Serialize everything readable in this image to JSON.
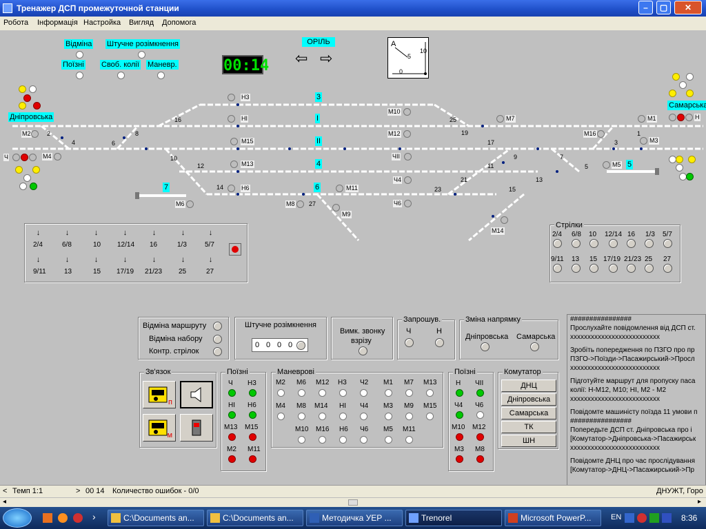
{
  "window": {
    "title": "Тренажер ДСП промежуточной станции",
    "min": "–",
    "max": "▢",
    "close": "✕"
  },
  "menu": [
    "Робота",
    "Інформація",
    "Настройка",
    "Вигляд",
    "Допомога"
  ],
  "legend": {
    "cancel": "Відміна",
    "artificial": "Штучне розімкнення",
    "train": "Поїзні",
    "free_tracks": "Своб. колії",
    "shunt": "Маневр."
  },
  "clock": "00:14",
  "direction": {
    "name": "ОРІЛЬ",
    "left": "⇦",
    "right": "⇨"
  },
  "meter": {
    "a": "A",
    "five": "5",
    "ten": "10",
    "zero": "0"
  },
  "stations": {
    "left": "Дніпровська",
    "right": "Самарська"
  },
  "tracks": [
    "3",
    "I",
    "II",
    "4",
    "6",
    "5",
    "7"
  ],
  "signals": [
    "Н3",
    "НІ",
    "М15",
    "М13",
    "Н6",
    "М11",
    "М10",
    "М12",
    "ЧІІ",
    "Ч4",
    "Ч6",
    "М7",
    "М1",
    "М16",
    "М3",
    "М5",
    "М2",
    "М4",
    "М6",
    "М8",
    "М9",
    "М14",
    "Н",
    "Ч"
  ],
  "switch_nums": [
    "2",
    "4",
    "6",
    "8",
    "10",
    "12",
    "14",
    "16",
    "25",
    "19",
    "17",
    "27",
    "21",
    "23",
    "15",
    "13",
    "11",
    "9",
    "7",
    "5",
    "3",
    "1"
  ],
  "routes": {
    "top": [
      "2/4",
      "6/8",
      "10",
      "12/14",
      "16",
      "1/3",
      "5/7"
    ],
    "bottom": [
      "9/11",
      "13",
      "15",
      "17/19",
      "21/23",
      "25",
      "27"
    ]
  },
  "strilky": {
    "title": "Стрілки",
    "top": [
      "2/4",
      "6/8",
      "10",
      "12/14",
      "16",
      "1/3",
      "5/7"
    ],
    "bottom": [
      "9/11",
      "13",
      "15",
      "17/19",
      "21/23",
      "25",
      "27"
    ]
  },
  "controls": {
    "cancel_route": "Відміна маршруту",
    "cancel_set": "Відміна набору",
    "check_switches": "Контр. стрілок",
    "artificial": "Штучне розімкнення",
    "digits": [
      "0",
      "0",
      "0",
      "0"
    ],
    "bell": "Вимк. звонку",
    "bell2": "взрізу",
    "request": "Запрошув.",
    "ch": "Ч",
    "n": "Н",
    "voltage": "Зміна напрямку",
    "dnipro": "Дніпровська",
    "samar": "Самарська"
  },
  "comm": {
    "title": "Зв'язок",
    "p": "п",
    "m": "м"
  },
  "train_left": {
    "title": "Поїзні",
    "items": [
      "Ч",
      "Н3",
      "НІ",
      "Н6",
      "М13",
      "М15",
      "М2",
      "М11"
    ]
  },
  "shunt": {
    "title": "Маневрові",
    "row1": [
      "М2",
      "М6",
      "М12",
      "Н3",
      "Ч2",
      "М1",
      "М7",
      "М13"
    ],
    "row2": [
      "М4",
      "М8",
      "М14",
      "НІ",
      "Ч4",
      "М3",
      "М9",
      "М15"
    ],
    "row3": [
      "М10",
      "М16",
      "Н6",
      "Ч6",
      "М5",
      "М11"
    ]
  },
  "train_right": {
    "title": "Поїзні",
    "items": [
      "Н",
      "ЧІІ",
      "Ч4",
      "Ч6",
      "М10",
      "М12",
      "М3",
      "М8"
    ]
  },
  "commutator": {
    "title": "Комутатор",
    "buttons": [
      "ДНЦ",
      "Дніпровська",
      "Самарська",
      "ТК",
      "ШН"
    ]
  },
  "messages": [
    "################",
    "Прослухайте повідомлення від ДСП ст.",
    "xxxxxxxxxxxxxxxxxxxxxxxxxx",
    "Зробіть попередження по ПЗГО про пр",
    "ПЗГО->Поїзди->Пасажирський->Просл",
    "xxxxxxxxxxxxxxxxxxxxxxxxxx",
    "Підготуйте маршрут для пропуску паса",
    "колії: Н-М12, М10; НІ, М2 - М2",
    "xxxxxxxxxxxxxxxxxxxxxxxxxx",
    "Повідомте машиністу поїзда 11 умови п",
    "################",
    "Попередьте ДСП ст. Дніпровська про і",
    "[Комутатор->Дніпровська->Пасажирськ",
    "xxxxxxxxxxxxxxxxxxxxxxxxxx",
    "Повідомте ДНЦ про час прослідування",
    "[Комутатор->ДНЦ->Пасажирський->Пр"
  ],
  "status": {
    "arrow_l": "<",
    "tempo": "Темп 1:1",
    "arrow_r": ">",
    "time": "00  14",
    "errors": "Количество ошибок - 0/0",
    "right": "ДНУЖТ, Горо"
  },
  "taskbar": {
    "start": "",
    "items": [
      "C:\\Documents an...",
      "C:\\Documents an...",
      "Методичка УЕР ...",
      "Trenorel",
      "Microsoft PowerP..."
    ],
    "lang": "EN",
    "time": "8:36"
  }
}
